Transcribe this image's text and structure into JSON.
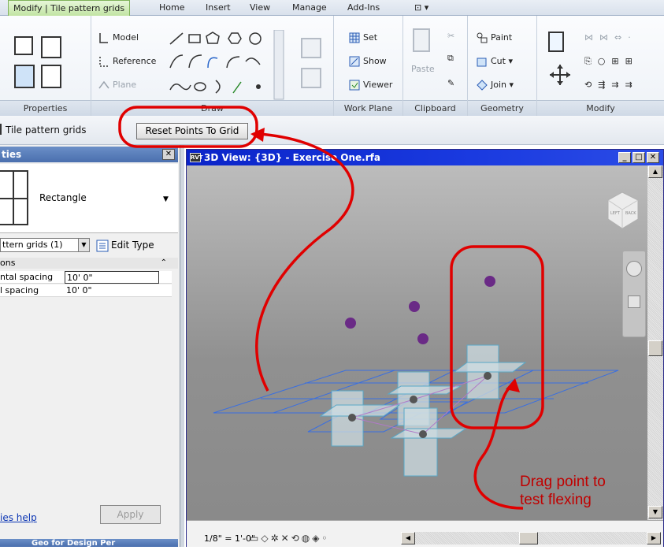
{
  "ribbon_tabs": [
    {
      "label": "Modify | Tile pattern grids",
      "active": true
    },
    {
      "label": "Home"
    },
    {
      "label": "Insert"
    },
    {
      "label": "View"
    },
    {
      "label": "Manage"
    },
    {
      "label": "Add-Ins"
    },
    {
      "label": "⊡ ▾"
    }
  ],
  "panels": {
    "properties": "Properties",
    "draw": "Draw",
    "work_plane": "Work Plane",
    "clipboard": "Clipboard",
    "geometry": "Geometry",
    "modify": "Modify"
  },
  "draw_tools": {
    "model": "Model",
    "reference": "Reference",
    "plane": "Plane"
  },
  "work_plane_tools": {
    "set": "Set",
    "show": "Show",
    "viewer": "Viewer"
  },
  "clipboard_tools": {
    "paste": "Paste"
  },
  "geometry_tools": {
    "paint": "Paint",
    "cut": "Cut",
    "join": "Join"
  },
  "options_bar": {
    "context": "Tile pattern grids",
    "reset_button": "Reset Points To Grid"
  },
  "properties_palette": {
    "title": "ties",
    "type_name": "Rectangle",
    "filter": "ttern grids (1)",
    "edit_type": "Edit Type",
    "group": "ons",
    "rows": [
      {
        "name": "ntal spacing",
        "value": "10'  0\""
      },
      {
        "name": "l spacing",
        "value": "10'  0\""
      }
    ],
    "help_link": "ies help",
    "apply": "Apply",
    "bottom_label": "Geo for Design Per"
  },
  "view_window": {
    "title": "3D View: {3D} - Exercise One.rfa",
    "scale": "1/8\" = 1'-0\"",
    "viewcube_labels": [
      "LEFT",
      "BACK"
    ]
  },
  "annotation": {
    "line1": "Drag point to",
    "line2": "test flexing"
  },
  "colors": {
    "title_bar": "#0a24c8",
    "grid_lines": "#3a6fe0",
    "points": "#6a2a86",
    "callout": "#e00000"
  }
}
